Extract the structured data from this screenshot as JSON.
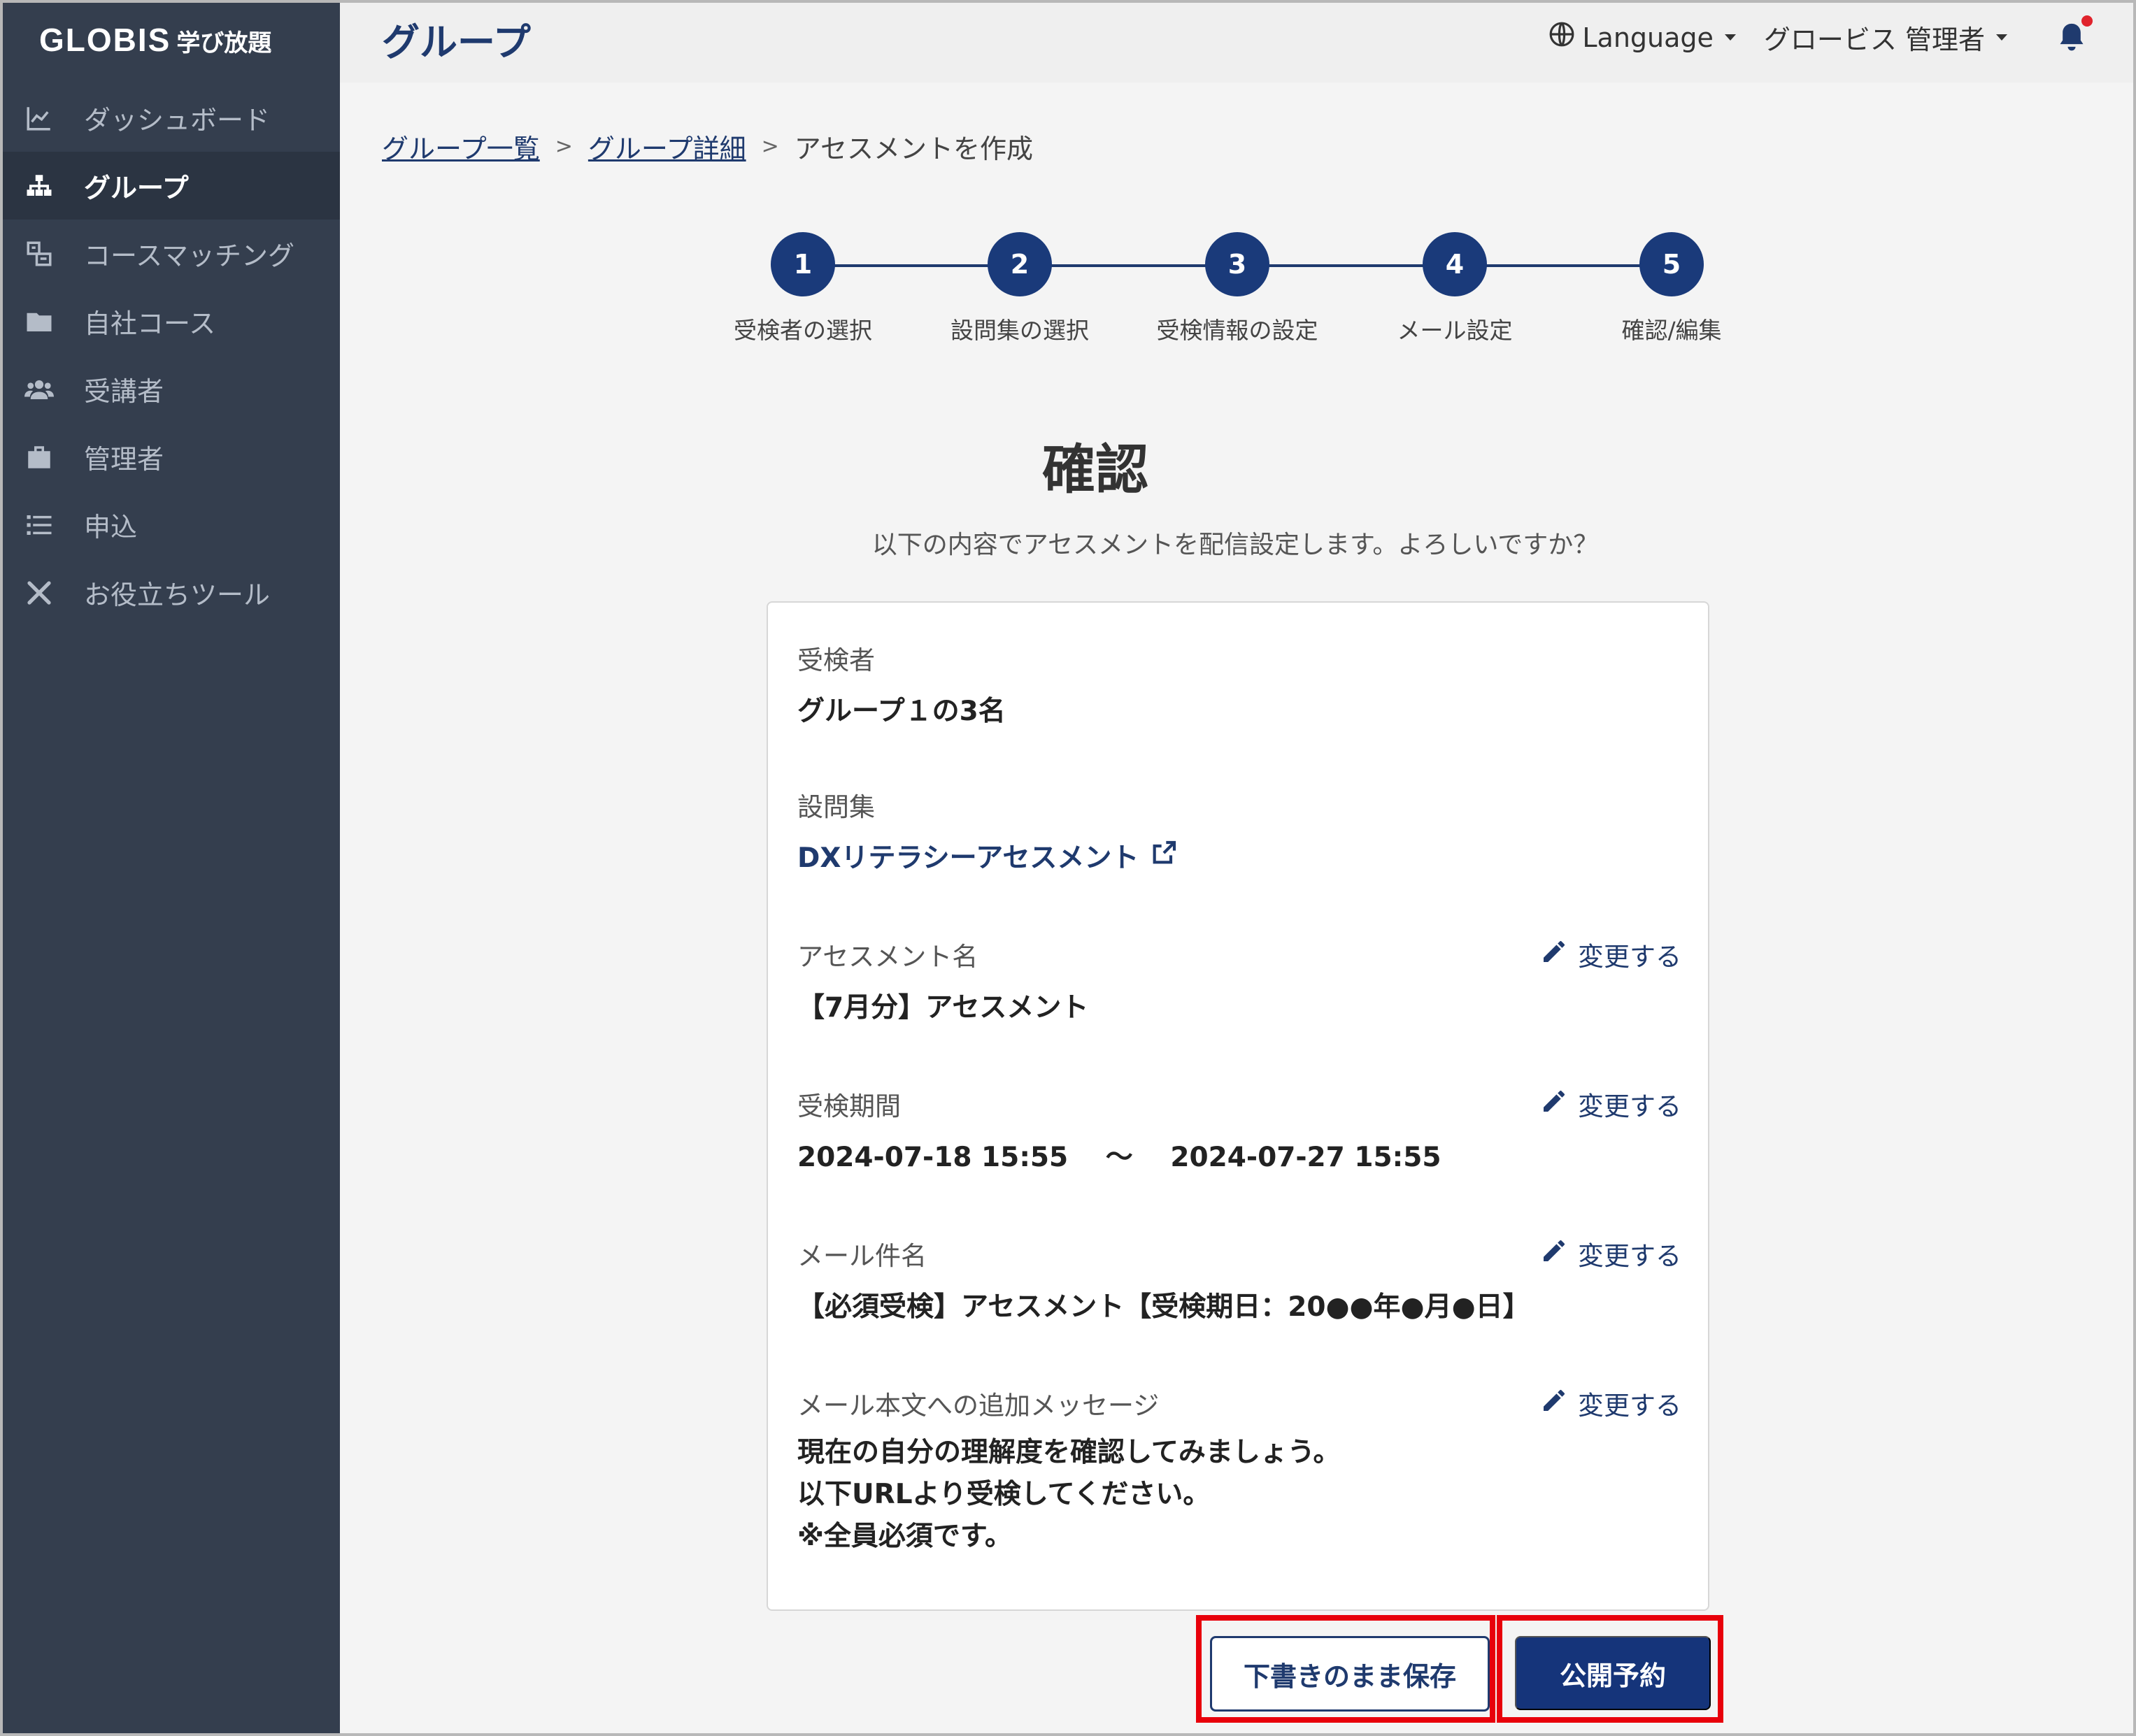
{
  "sidebar": {
    "logo_brand": "GLOBIS",
    "logo_sub": "学び放題",
    "items": [
      {
        "label": "ダッシュボード",
        "icon": "chart-line-icon",
        "active": false
      },
      {
        "label": "グループ",
        "icon": "sitemap-icon",
        "active": true
      },
      {
        "label": "コースマッチング",
        "icon": "course-matching-icon",
        "active": false
      },
      {
        "label": "自社コース",
        "icon": "folder-icon",
        "active": false
      },
      {
        "label": "受講者",
        "icon": "users-icon",
        "active": false
      },
      {
        "label": "管理者",
        "icon": "briefcase-icon",
        "active": false
      },
      {
        "label": "申込",
        "icon": "list-icon",
        "active": false
      },
      {
        "label": "お役立ちツール",
        "icon": "tools-icon",
        "active": false
      }
    ]
  },
  "header": {
    "title": "グループ",
    "language_label": "Language",
    "user_label": "グロービス 管理者"
  },
  "breadcrumb": {
    "items": [
      "グループ一覧",
      "グループ詳細"
    ],
    "current": "アセスメントを作成",
    "separator": ">"
  },
  "stepper": {
    "steps": [
      {
        "number": "1",
        "label": "受検者の選択"
      },
      {
        "number": "2",
        "label": "設問集の選択"
      },
      {
        "number": "3",
        "label": "受検情報の設定"
      },
      {
        "number": "4",
        "label": "メール設定"
      },
      {
        "number": "5",
        "label": "確認/編集"
      }
    ]
  },
  "confirm": {
    "title": "確認",
    "description": "以下の内容でアセスメントを配信設定します。よろしいですか？",
    "edit_label": "変更する",
    "fields": {
      "examinee": {
        "label": "受検者",
        "value": "グループ１の3名"
      },
      "question_set": {
        "label": "設問集",
        "value": "DXリテラシーアセスメント"
      },
      "assessment_name": {
        "label": "アセスメント名",
        "value": "【7月分】アセスメント"
      },
      "period": {
        "label": "受検期間",
        "start": "2024-07-18 15:55",
        "separator": "〜",
        "end": "2024-07-27 15:55"
      },
      "mail_subject": {
        "label": "メール件名",
        "value": "【必須受検】アセスメント【受検期日：20●●年●月●日】"
      },
      "mail_message": {
        "label": "メール本文への追加メッセージ",
        "lines": [
          "現在の自分の理解度を確認してみましょう。",
          "以下URLより受検してください。",
          "※全員必須です。"
        ]
      }
    }
  },
  "actions": {
    "draft_label": "下書きのまま保存",
    "publish_label": "公開予約"
  },
  "colors": {
    "sidebar_bg": "#343e4e",
    "accent": "#1a3a7a",
    "highlight": "#e8000b",
    "notification_dot": "#e0232c"
  }
}
